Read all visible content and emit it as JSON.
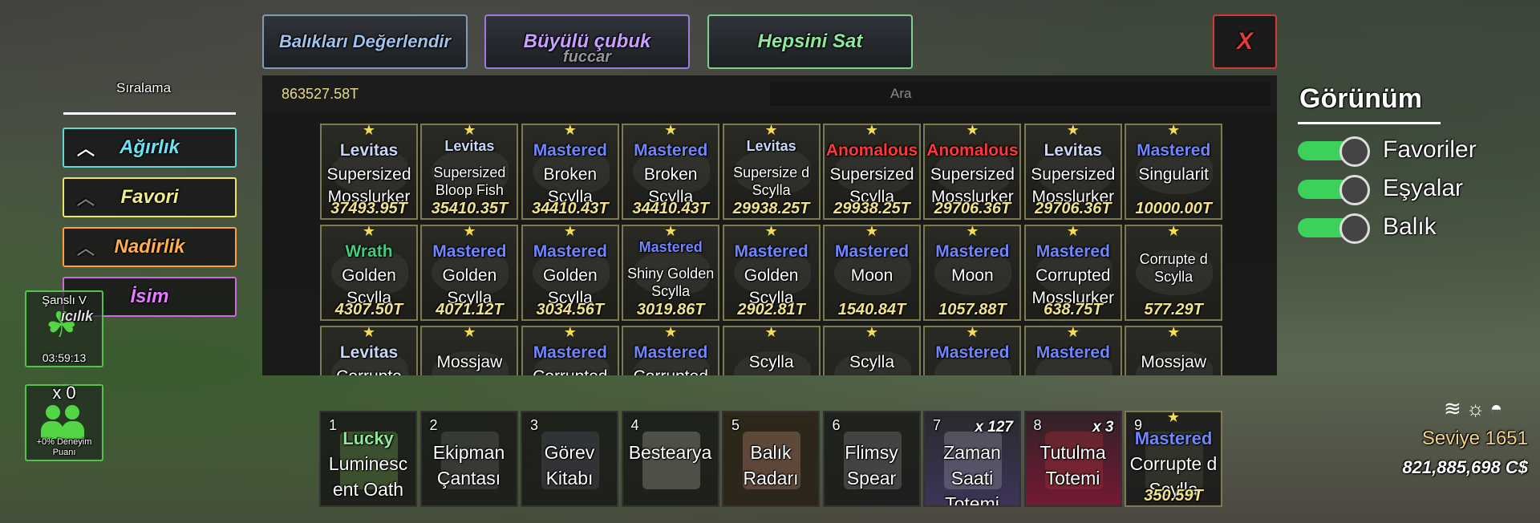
{
  "top_buttons": {
    "appraise": "Balıkları Değerlendir",
    "magic_rod": "Büyülü çubuk",
    "magic_rod_sub": "fuccar",
    "sell_all": "Hepsini Sat",
    "close": "X"
  },
  "inventory": {
    "total_value": "863527.58T",
    "search_placeholder": "Ara",
    "items": [
      {
        "mutation": "Levitas",
        "mutation_type": "levitas",
        "name": "Supersized Mosslurker",
        "value": "37493.95T"
      },
      {
        "mutation": "Levitas",
        "mutation_type": "levitas",
        "name": "Supersized Bloop Fish",
        "value": "35410.35T"
      },
      {
        "mutation": "Mastered",
        "mutation_type": "mastered",
        "name": "Broken Scylla",
        "value": "34410.43T"
      },
      {
        "mutation": "Mastered",
        "mutation_type": "mastered",
        "name": "Broken Scylla",
        "value": "34410.43T"
      },
      {
        "mutation": "Levitas",
        "mutation_type": "levitas",
        "name": "Supersize d Scylla",
        "value": "29938.25T"
      },
      {
        "mutation": "Anomalous",
        "mutation_type": "anomalous",
        "name": "Supersized Scylla",
        "value": "29938.25T"
      },
      {
        "mutation": "Anomalous",
        "mutation_type": "anomalous",
        "name": "Supersized Mosslurker",
        "value": "29706.36T"
      },
      {
        "mutation": "Levitas",
        "mutation_type": "levitas",
        "name": "Supersized Mosslurker",
        "value": "29706.36T"
      },
      {
        "mutation": "Mastered",
        "mutation_type": "mastered",
        "name": "Singularit",
        "value": "10000.00T"
      },
      {
        "mutation": "Wrath",
        "mutation_type": "wrath",
        "name": "Golden Scylla",
        "value": "4307.50T"
      },
      {
        "mutation": "Mastered",
        "mutation_type": "mastered",
        "name": "Golden Scylla",
        "value": "4071.12T"
      },
      {
        "mutation": "Mastered",
        "mutation_type": "mastered",
        "name": "Golden Scylla",
        "value": "3034.56T"
      },
      {
        "mutation": "Mastered",
        "mutation_type": "mastered",
        "name": "Shiny Golden Scylla",
        "value": "3019.86T"
      },
      {
        "mutation": "Mastered",
        "mutation_type": "mastered",
        "name": "Golden Scylla",
        "value": "2902.81T"
      },
      {
        "mutation": "Mastered",
        "mutation_type": "mastered",
        "name": "Moon",
        "value": "1540.84T"
      },
      {
        "mutation": "Mastered",
        "mutation_type": "mastered",
        "name": "Moon",
        "value": "1057.88T"
      },
      {
        "mutation": "Mastered",
        "mutation_type": "mastered",
        "name": "Corrupted Mosslurker",
        "value": "638.75T"
      },
      {
        "mutation": "",
        "mutation_type": "none",
        "name": "Corrupte d Scylla",
        "value": "577.29T"
      },
      {
        "mutation": "Levitas",
        "mutation_type": "levitas",
        "name": "Corrupte",
        "value": ""
      },
      {
        "mutation": "",
        "mutation_type": "none",
        "name": "Mossjaw",
        "value": ""
      },
      {
        "mutation": "Mastered",
        "mutation_type": "mastered",
        "name": "Corrupted",
        "value": ""
      },
      {
        "mutation": "Mastered",
        "mutation_type": "mastered",
        "name": "Corrupted",
        "value": ""
      },
      {
        "mutation": "",
        "mutation_type": "none",
        "name": "Scylla",
        "value": ""
      },
      {
        "mutation": "",
        "mutation_type": "none",
        "name": "Scylla",
        "value": ""
      },
      {
        "mutation": "Mastered",
        "mutation_type": "mastered",
        "name": "",
        "value": ""
      },
      {
        "mutation": "Mastered",
        "mutation_type": "mastered",
        "name": "",
        "value": ""
      },
      {
        "mutation": "",
        "mutation_type": "none",
        "name": "Mossjaw",
        "value": ""
      }
    ]
  },
  "sort": {
    "title": "Sıralama",
    "options": [
      "Ağırlık",
      "Favori",
      "Nadirlik",
      "İsim"
    ]
  },
  "boosts": {
    "luck_title": "Şanslı V",
    "luck_overlay": "ıcılık",
    "luck_timer": "03:59:13",
    "xp_multiplier": "x 0",
    "xp_label": "+0% Deneyim Puanı"
  },
  "view": {
    "title": "Görünüm",
    "toggles": [
      {
        "label": "Favoriler",
        "on": true
      },
      {
        "label": "Eşyalar",
        "on": true
      },
      {
        "label": "Balık",
        "on": true
      }
    ]
  },
  "hotbar": [
    {
      "slot": "1",
      "tag": "Lucky",
      "name": "Luminesc ent Oath",
      "qty": ""
    },
    {
      "slot": "2",
      "tag": "",
      "name": "Ekipman Çantası",
      "qty": ""
    },
    {
      "slot": "3",
      "tag": "",
      "name": "Görev Kitabı",
      "qty": ""
    },
    {
      "slot": "4",
      "tag": "",
      "name": "Bestearya",
      "qty": ""
    },
    {
      "slot": "5",
      "tag": "",
      "name": "Balık Radarı",
      "qty": ""
    },
    {
      "slot": "6",
      "tag": "",
      "name": "Flimsy Spear",
      "qty": ""
    },
    {
      "slot": "7",
      "tag": "",
      "name": "Zaman Saati Totemi",
      "qty": "x 127"
    },
    {
      "slot": "8",
      "tag": "",
      "name": "Tutulma Totemi",
      "qty": "x 3"
    },
    {
      "slot": "9",
      "tag": "Mastered",
      "name": "Corrupte d Scylla",
      "qty": "",
      "value": "350.59T"
    }
  ],
  "status": {
    "weather_icons": "wind-icon sun-icon sunrise-icon",
    "level": "Seviye 1651",
    "currency": "821,885,698 C$"
  },
  "colors": {
    "mastered": "#6f86ff",
    "anomalous": "#ff3737",
    "levitas": "#c8d7f7",
    "wrath": "#3fcf7a",
    "value": "#f1e38a",
    "toggle_on": "#3cd15a"
  }
}
